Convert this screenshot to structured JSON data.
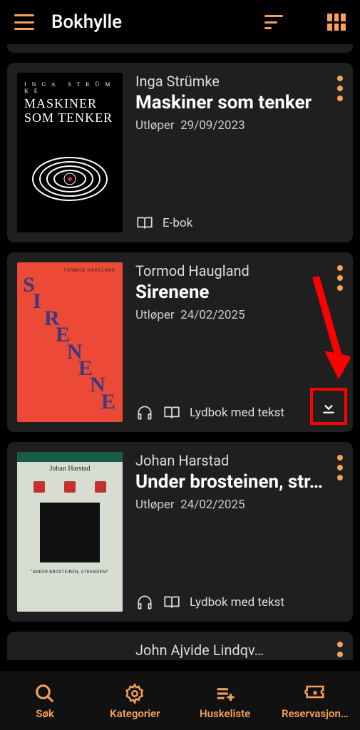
{
  "header": {
    "title": "Bokhylle"
  },
  "books": [
    {
      "author": "Inga Strümke",
      "title": "Maskiner som tenker",
      "expiry_label": "Utløper",
      "expiry_date": "29/09/2023",
      "format": "E-bok",
      "has_headphones": false,
      "has_download": false
    },
    {
      "author": "Tormod Haugland",
      "title": "Sirenene",
      "expiry_label": "Utløper",
      "expiry_date": "24/02/2025",
      "format": "Lydbok med tekst",
      "has_headphones": true,
      "has_download": true
    },
    {
      "author": "Johan Harstad",
      "title": "Under brosteinen, str…",
      "expiry_label": "Utløper",
      "expiry_date": "24/02/2025",
      "format": "Lydbok med tekst",
      "has_headphones": true,
      "has_download": false
    }
  ],
  "partial_book": {
    "author": "John Ajvide Lindqv…"
  },
  "nav": {
    "search": "Søk",
    "categories": "Kategorier",
    "wishlist": "Huskeliste",
    "reservations": "Reservasjon…"
  },
  "colors": {
    "accent": "#f5a15a",
    "annotation": "#ff0000"
  }
}
